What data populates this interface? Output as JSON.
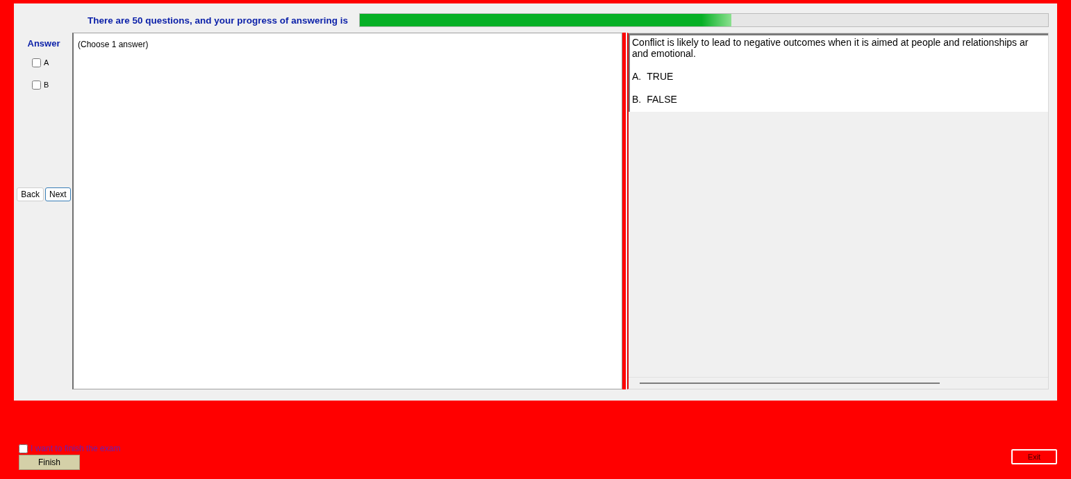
{
  "header": {
    "text": "There are 50 questions, and your progress of answering is",
    "progress": {
      "level": 0.54
    }
  },
  "answer_panel": {
    "title": "Answer",
    "options": [
      {
        "label": "A",
        "checked": false
      },
      {
        "label": "B",
        "checked": false
      }
    ]
  },
  "navigation": {
    "buttons": [
      {
        "label": "Back",
        "selected": false
      },
      {
        "label": "Next",
        "selected": true
      }
    ]
  },
  "instruction": "(Choose 1 answer)",
  "question": {
    "lines": [
      "Conflict is likely to lead to negative outcomes when it is aimed at people and relationships ar",
      "and emotional."
    ],
    "choices": [
      {
        "letter": "A.",
        "text": "TRUE"
      },
      {
        "letter": "B.",
        "text": "FALSE"
      }
    ]
  },
  "finish": {
    "label": "I want to finish the exam",
    "checked": false,
    "button": "Finish"
  },
  "exit_button": "Exit"
}
